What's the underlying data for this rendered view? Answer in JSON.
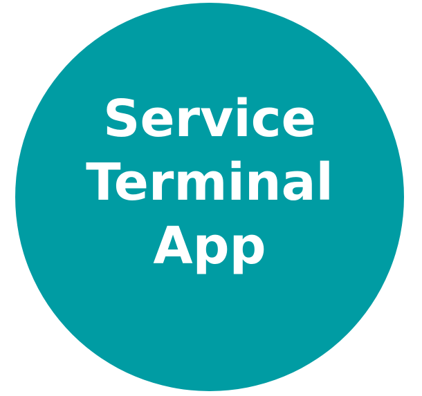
{
  "logo": {
    "lines": [
      "Service",
      "Terminal",
      "App"
    ],
    "background_color": "#009ca3",
    "text_color": "#ffffff"
  }
}
